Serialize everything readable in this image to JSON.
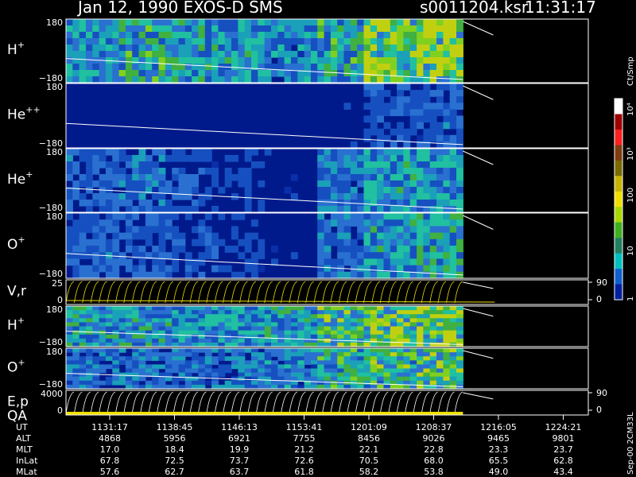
{
  "header": {
    "title": "Jan 12, 1990   EXOS-D SMS",
    "file": "s0011204.ksr",
    "time": "11:31:17"
  },
  "side_labels": {
    "units": "Ct/Smp",
    "version": "Sep-00 2CM33L"
  },
  "colorbar": {
    "ticks": [
      "10⁴",
      "10³",
      "100",
      "10",
      "1"
    ],
    "colors": [
      "#ffffff",
      "#a00000",
      "#ff2020",
      "#803c10",
      "#7a6a00",
      "#c8b400",
      "#f0e000",
      "#a8d800",
      "#40b020",
      "#208060",
      "#00c0c0",
      "#1060d0",
      "#0020a0"
    ]
  },
  "chart_data": {
    "type": "heatmap",
    "title": "Jan 12, 1990   EXOS-D SMS",
    "x_ticks": [
      "1131:17",
      "1138:45",
      "1146:13",
      "1153:41",
      "1201:09",
      "1208:37",
      "1216:05",
      "1224:21"
    ],
    "data_end_fraction": 0.76,
    "panels": [
      {
        "label": "H",
        "sup": "+",
        "ymax": "180",
        "ymin": "−180",
        "kind": "spectrogram",
        "intensity": [
          0.45,
          0.55,
          0.5,
          0.45,
          0.4,
          0.55,
          0.75,
          0.8
        ]
      },
      {
        "label": "He",
        "sup": "++",
        "ymax": "180",
        "ymin": "−180",
        "kind": "spectrogram",
        "intensity": [
          0.1,
          0.1,
          0.1,
          0.1,
          0.1,
          0.15,
          0.25,
          0.3
        ]
      },
      {
        "label": "He",
        "sup": "+",
        "ymax": "180",
        "ymin": "−180",
        "kind": "spectrogram",
        "intensity": [
          0.3,
          0.35,
          0.25,
          0.2,
          0.15,
          0.35,
          0.45,
          0.45
        ]
      },
      {
        "label": "O",
        "sup": "+",
        "ymax": "180",
        "ymin": "−180",
        "kind": "spectrogram",
        "intensity": [
          0.3,
          0.3,
          0.25,
          0.2,
          0.15,
          0.35,
          0.45,
          0.5
        ]
      },
      {
        "label": "V,r",
        "sup": "",
        "ymax": "25",
        "ymin": "0",
        "kind": "trace",
        "right_ticks": [
          "90",
          "0"
        ]
      },
      {
        "label": "H",
        "sup": "+",
        "ymax": "180",
        "ymin": "−180",
        "kind": "spectrogram",
        "intensity": [
          0.5,
          0.5,
          0.45,
          0.45,
          0.5,
          0.65,
          0.75,
          0.8
        ]
      },
      {
        "label": "O",
        "sup": "+",
        "ymax": "180",
        "ymin": "−180",
        "kind": "spectrogram",
        "intensity": [
          0.35,
          0.35,
          0.35,
          0.35,
          0.4,
          0.55,
          0.6,
          0.65
        ]
      },
      {
        "label": "E,p",
        "sup": "",
        "label2": "QA",
        "ymax": "4000",
        "ymin": "0",
        "kind": "trace",
        "right_ticks": [
          "90",
          "0"
        ]
      }
    ],
    "table": {
      "rows": [
        {
          "name": "UT",
          "values": [
            "1131:17",
            "1138:45",
            "1146:13",
            "1153:41",
            "1201:09",
            "1208:37",
            "1216:05",
            "1224:21"
          ]
        },
        {
          "name": "ALT",
          "values": [
            "4868",
            "5956",
            "6921",
            "7755",
            "8456",
            "9026",
            "9465",
            "9801"
          ]
        },
        {
          "name": "MLT",
          "values": [
            "17.0",
            "18.4",
            "19.9",
            "21.2",
            "22.1",
            "22.8",
            "23.3",
            "23.7"
          ]
        },
        {
          "name": "InLat",
          "values": [
            "67.8",
            "72.5",
            "73.7",
            "72.6",
            "70.5",
            "68.0",
            "65.5",
            "62.8"
          ]
        },
        {
          "name": "MLat",
          "values": [
            "57.6",
            "62.7",
            "63.7",
            "61.8",
            "58.2",
            "53.8",
            "49.0",
            "43.4"
          ]
        }
      ]
    }
  }
}
